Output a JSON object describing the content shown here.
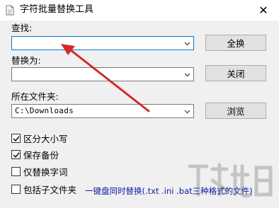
{
  "window": {
    "title": "字符批量替换工具",
    "close_glyph": "✕"
  },
  "find": {
    "label": "查找:",
    "value": "",
    "button": "全换"
  },
  "replace": {
    "label": "替换为:",
    "value": "",
    "button": "关闭"
  },
  "folder": {
    "label": "所在文件夹:",
    "value": "C:\\Downloads",
    "button": "浏览"
  },
  "options": [
    {
      "label": "区分大小写",
      "checked": true
    },
    {
      "label": "保存备份",
      "checked": true
    },
    {
      "label": "仅替换字词",
      "checked": false
    },
    {
      "label": "包括子文件夹",
      "checked": false
    }
  ],
  "hint": "一键盘同时替换(.txt .ini .bat三种格式的文件)",
  "colors": {
    "annotation_arrow": "#d42a2a",
    "hint_text": "#0a1aa8",
    "focus_border": "#0078d7"
  }
}
